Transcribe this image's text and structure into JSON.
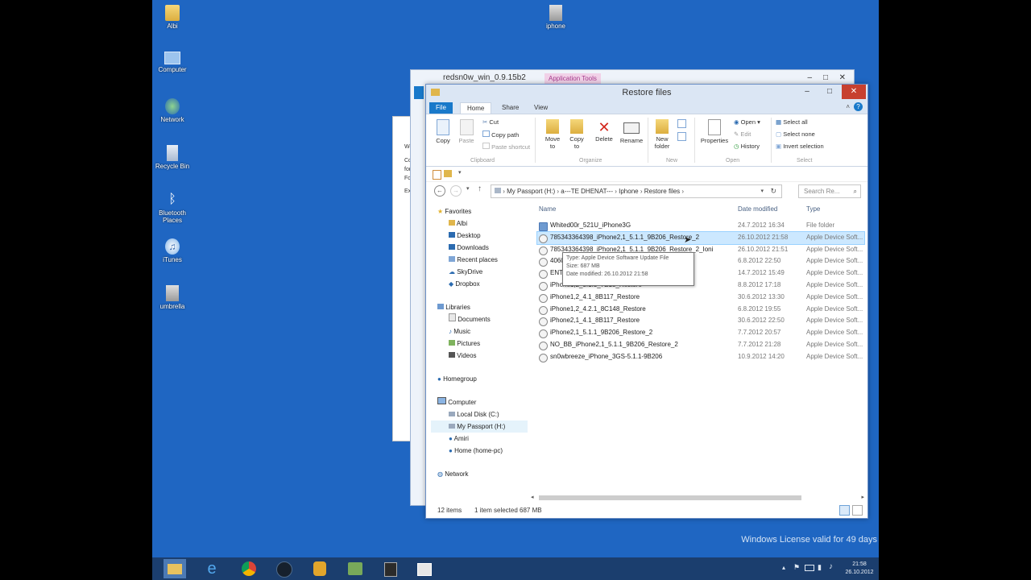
{
  "desktop": {
    "icons": [
      {
        "label": "Albi"
      },
      {
        "label": "Computer"
      },
      {
        "label": "Network"
      },
      {
        "label": "Recycle Bin"
      },
      {
        "label": "Bluetooth Places"
      },
      {
        "label": "iTunes"
      },
      {
        "label": "umbrella"
      },
      {
        "label": "iphone"
      }
    ],
    "license_text": "Windows License valid for 49 days"
  },
  "background_window": {
    "title": "redsn0w_win_0.9.15b2",
    "context_tab": "Application Tools",
    "panel_text": [
      "Welcom",
      "Copying",
      "for com",
      "For su",
      "Extra"
    ]
  },
  "window": {
    "title": "Restore files",
    "tabs": [
      "File",
      "Home",
      "Share",
      "View"
    ],
    "ribbon": {
      "clipboard": {
        "copy": "Copy",
        "paste": "Paste",
        "cut": "Cut",
        "copy_path": "Copy path",
        "paste_shortcut": "Paste shortcut",
        "group": "Clipboard"
      },
      "organize": {
        "move_to": "Move to",
        "copy_to": "Copy to",
        "delete": "Delete",
        "rename": "Rename",
        "group": "Organize"
      },
      "new": {
        "new_folder": "New folder",
        "group": "New"
      },
      "open": {
        "properties": "Properties",
        "open": "Open",
        "edit": "Edit",
        "history": "History",
        "group": "Open"
      },
      "select": {
        "select_all": "Select all",
        "select_none": "Select none",
        "invert": "Invert selection",
        "group": "Select"
      }
    },
    "address": {
      "segments": [
        "My Passport (H:)",
        "a---TE DHENAT---",
        "Iphone",
        "Restore files"
      ],
      "search_placeholder": "Search Re..."
    },
    "nav": {
      "favorites": {
        "label": "Favorites",
        "items": [
          "Albi",
          "Desktop",
          "Downloads",
          "Recent places",
          "SkyDrive",
          "Dropbox"
        ]
      },
      "libraries": {
        "label": "Libraries",
        "items": [
          "Documents",
          "Music",
          "Pictures",
          "Videos"
        ]
      },
      "homegroup": "Homegroup",
      "computer": {
        "label": "Computer",
        "items": [
          "Local Disk (C:)",
          "My Passport (H:)",
          "Amiri",
          "Home (home-pc)"
        ]
      },
      "network": "Network"
    },
    "columns": {
      "name": "Name",
      "date": "Date modified",
      "type": "Type"
    },
    "files": [
      {
        "name": "Whited00r_521U_iPhone3G",
        "date": "24.7.2012 16:34",
        "type": "File folder"
      },
      {
        "name": "785343364398_iPhone2,1_5.1.1_9B206_Restore_2",
        "date": "26.10.2012 21:58",
        "type": "Apple Device Soft..."
      },
      {
        "name": "785343364398_iPhone2,1_5.1.1_9B206_Restore_2_Ioni",
        "date": "26.10.2012 21:51",
        "type": "Apple Device Soft..."
      },
      {
        "name": "4060",
        "date": "6.8.2012 22:50",
        "type": "Apple Device Soft..."
      },
      {
        "name": "ENT",
        "date": "14.7.2012 15:49",
        "type": "Apple Device Soft..."
      },
      {
        "name": "iPhone1,2_3.1.3_7E18_Restore",
        "date": "8.8.2012 17:18",
        "type": "Apple Device Soft..."
      },
      {
        "name": "iPhone1,2_4.1_8B117_Restore",
        "date": "30.6.2012 13:30",
        "type": "Apple Device Soft..."
      },
      {
        "name": "iPhone1,2_4.2.1_8C148_Restore",
        "date": "6.8.2012 19:55",
        "type": "Apple Device Soft..."
      },
      {
        "name": "iPhone2,1_4.1_8B117_Restore",
        "date": "30.6.2012 22:50",
        "type": "Apple Device Soft..."
      },
      {
        "name": "iPhone2,1_5.1.1_9B206_Restore_2",
        "date": "7.7.2012 20:57",
        "type": "Apple Device Soft..."
      },
      {
        "name": "NO_BB_iPhone2,1_5.1.1_9B206_Restore_2",
        "date": "7.7.2012 21:28",
        "type": "Apple Device Soft..."
      },
      {
        "name": "sn0wbreeze_iPhone_3GS-5.1.1-9B206",
        "date": "10.9.2012 14:20",
        "type": "Apple Device Soft..."
      }
    ],
    "tooltip": {
      "type": "Type: Apple Device Software Update File",
      "size": "Size: 687 MB",
      "date": "Date modified: 26.10.2012 21:58"
    },
    "status": {
      "items": "12 items",
      "selected": "1 item selected  687 MB"
    }
  },
  "taskbar": {
    "time": "21:58",
    "date": "26.10.2012"
  },
  "colors": {
    "desktop": "#1f66c2",
    "selection": "#cce8ff",
    "accent": "#1979ca"
  }
}
